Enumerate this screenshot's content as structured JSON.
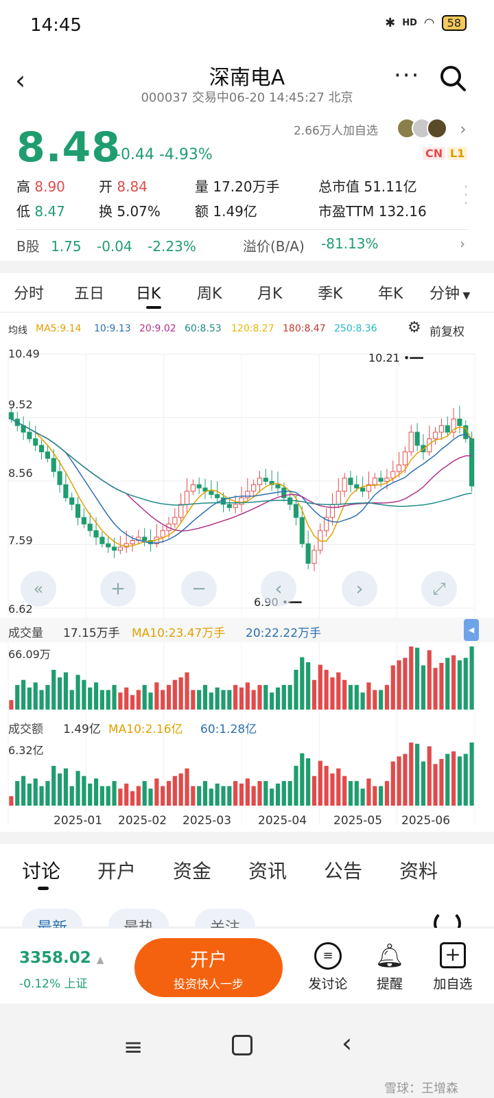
{
  "status_bar": {
    "time": "14:45",
    "network": "HD",
    "battery": "58"
  },
  "header": {
    "title": "深南电A",
    "subtitle": "000037 交易中06-20 14:45:27 北京",
    "price": "8.48",
    "change": "-0.44",
    "change_pct": "-4.93%",
    "followers": "2.66万人加自选",
    "badge_cn": "CN",
    "badge_l1": "L1"
  },
  "stats": {
    "high_label": "高",
    "high": "8.90",
    "open_label": "开",
    "open": "8.84",
    "vol_label": "量",
    "vol": "17.20万手",
    "mcap_label": "总市值",
    "mcap": "51.11亿",
    "low_label": "低",
    "low": "8.47",
    "turn_label": "换",
    "turn": "5.07%",
    "amt_label": "额",
    "amt": "1.49亿",
    "pe_label": "市盈TTM",
    "pe": "132.16"
  },
  "bshare": {
    "label": "B股",
    "price": "1.75",
    "change": "-0.04",
    "change_pct": "-2.23%",
    "premium_label": "溢价(B/A)",
    "premium": "-81.13%"
  },
  "ktabs": [
    "分时",
    "五日",
    "日K",
    "周K",
    "月K",
    "季K",
    "年K",
    "分钟"
  ],
  "ma_legend": {
    "label": "均线",
    "items": [
      {
        "text": "MA5:9.14",
        "color": "#e0a000"
      },
      {
        "text": "10:9.13",
        "color": "#2a6fb0"
      },
      {
        "text": "20:9.02",
        "color": "#b0308a"
      },
      {
        "text": "60:8.53",
        "color": "#1f8a8a"
      },
      {
        "text": "120:8.27",
        "color": "#e6b800"
      },
      {
        "text": "180:8.47",
        "color": "#c0392b"
      },
      {
        "text": "250:8.36",
        "color": "#22b8c8"
      }
    ],
    "adjust_label": "前复权"
  },
  "chart_data": {
    "type": "candlestick",
    "y_ticks": [
      "10.49",
      "9.52",
      "8.56",
      "7.59",
      "6.62"
    ],
    "ylim": [
      6.62,
      10.49
    ],
    "high_annotation": "10.21",
    "low_annotation": "6.90",
    "x_labels": [
      "2025-01",
      "2025-02",
      "2025-03",
      "2025-04",
      "2025-05",
      "2025-06"
    ],
    "close_series": [
      9.5,
      9.4,
      9.3,
      9.2,
      9.1,
      9.0,
      8.9,
      8.7,
      8.5,
      8.3,
      8.2,
      8.0,
      7.9,
      7.8,
      7.7,
      7.6,
      7.55,
      7.5,
      7.55,
      7.6,
      7.65,
      7.7,
      7.65,
      7.6,
      7.7,
      7.8,
      7.9,
      8.0,
      8.2,
      8.4,
      8.5,
      8.45,
      8.4,
      8.35,
      8.3,
      8.2,
      8.15,
      8.2,
      8.3,
      8.4,
      8.5,
      8.6,
      8.55,
      8.5,
      8.45,
      8.3,
      8.2,
      8.0,
      7.6,
      7.3,
      7.5,
      7.8,
      8.0,
      8.2,
      8.4,
      8.6,
      8.5,
      8.45,
      8.4,
      8.5,
      8.6,
      8.55,
      8.6,
      8.7,
      8.8,
      9.0,
      9.3,
      9.1,
      9.0,
      9.2,
      9.3,
      9.4,
      9.3,
      9.5,
      9.4,
      9.2,
      8.48
    ],
    "volume": {
      "label": "成交量",
      "value": "17.15万手",
      "ma10": "MA10:23.47万手",
      "ma20": "20:22.22万手",
      "max_label": "66.09万"
    },
    "amount": {
      "label": "成交额",
      "value": "1.49亿",
      "ma10": "MA10:2.16亿",
      "ma60": "60:1.28亿",
      "max_label": "6.32亿"
    },
    "controls": [
      "«",
      "+",
      "−",
      "‹",
      "›",
      "⤢"
    ]
  },
  "bottom_tabs": [
    "讨论",
    "开户",
    "资金",
    "资讯",
    "公告",
    "资料"
  ],
  "sub_pills": [
    "最新",
    "最热",
    "关注"
  ],
  "footer": {
    "index_value": "3358.02",
    "index_change": "-0.12% 上证",
    "open_account": "开户",
    "open_account_sub": "投资快人一步",
    "actions": [
      "发讨论",
      "提醒",
      "加自选"
    ]
  },
  "watermark": "雪球：王增森"
}
